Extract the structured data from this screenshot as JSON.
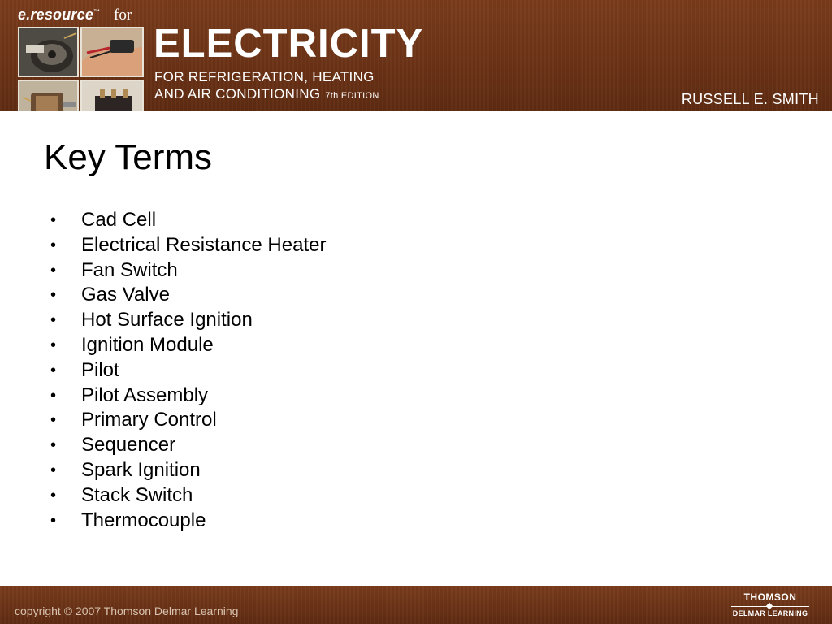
{
  "header": {
    "brand": "e.resource",
    "for_label": "for",
    "title": "ELECTRICITY",
    "subtitle_line1": "FOR REFRIGERATION, HEATING",
    "subtitle_line2": "AND AIR CONDITIONING",
    "edition": "7th EDITION",
    "author": "RUSSELL E. SMITH",
    "colors": {
      "banner": "#6e3418",
      "text": "#ffffff"
    }
  },
  "slide": {
    "title": "Key Terms",
    "terms": [
      "Cad Cell",
      "Electrical Resistance Heater",
      "Fan Switch",
      "Gas Valve",
      "Hot Surface Ignition",
      "Ignition Module",
      "Pilot",
      "Pilot Assembly",
      "Primary Control",
      "Sequencer",
      "Spark Ignition",
      "Stack Switch",
      "Thermocouple"
    ]
  },
  "footer": {
    "copyright": "copyright © 2007 Thomson Delmar Learning",
    "brand_line1": "THOMSON",
    "brand_line2": "DELMAR LEARNING"
  }
}
